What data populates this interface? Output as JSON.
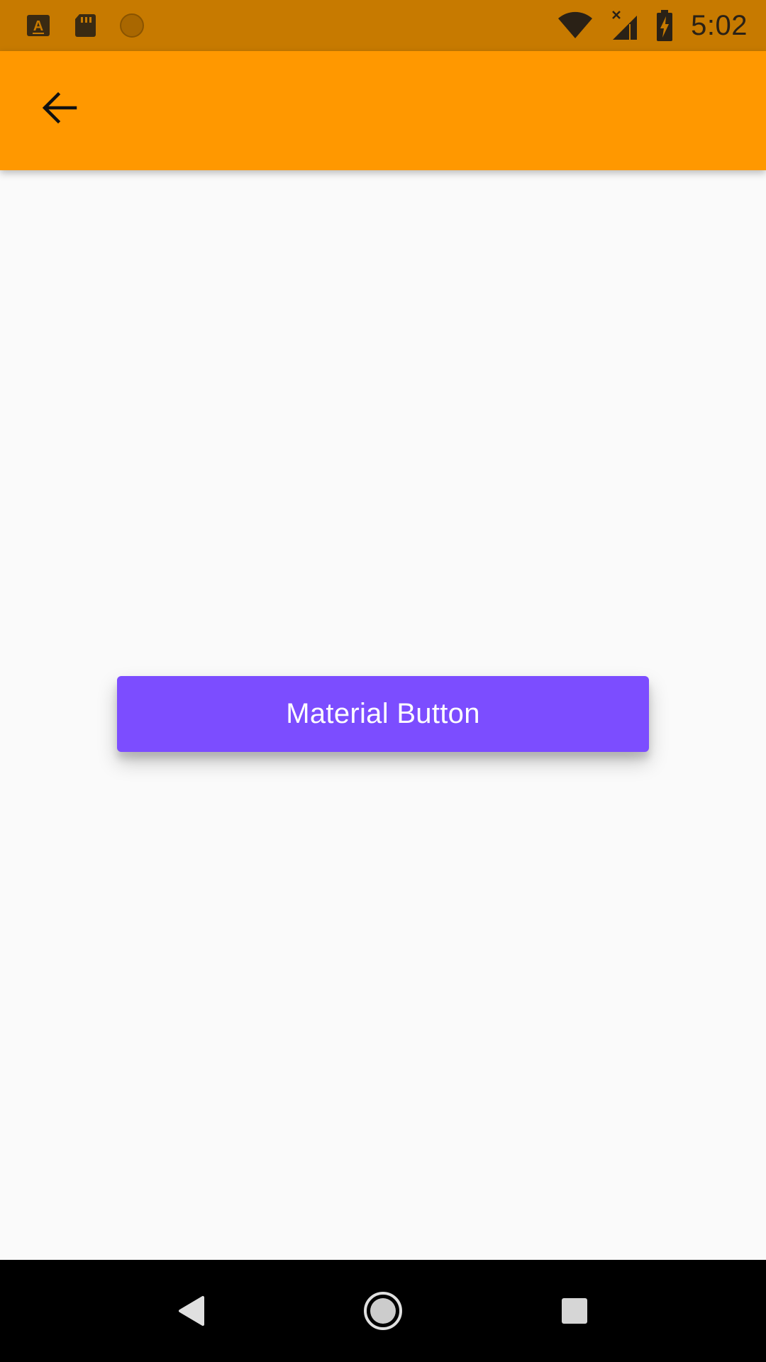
{
  "status_bar": {
    "time": "5:02",
    "background": "#c77a00",
    "icons_left": [
      "accessibility-a-icon",
      "sd-card-icon",
      "circle-notification-icon"
    ],
    "icons_right": [
      "wifi-icon",
      "cell-signal-no-service-icon",
      "battery-charging-icon"
    ]
  },
  "app_bar": {
    "background": "#ff9800",
    "back_icon": "arrow-back-icon"
  },
  "main": {
    "button_label": "Material Button",
    "button_color": "#7c4dff"
  },
  "nav_bar": {
    "buttons": [
      "back-triangle-icon",
      "home-circle-icon",
      "recents-square-icon"
    ]
  }
}
